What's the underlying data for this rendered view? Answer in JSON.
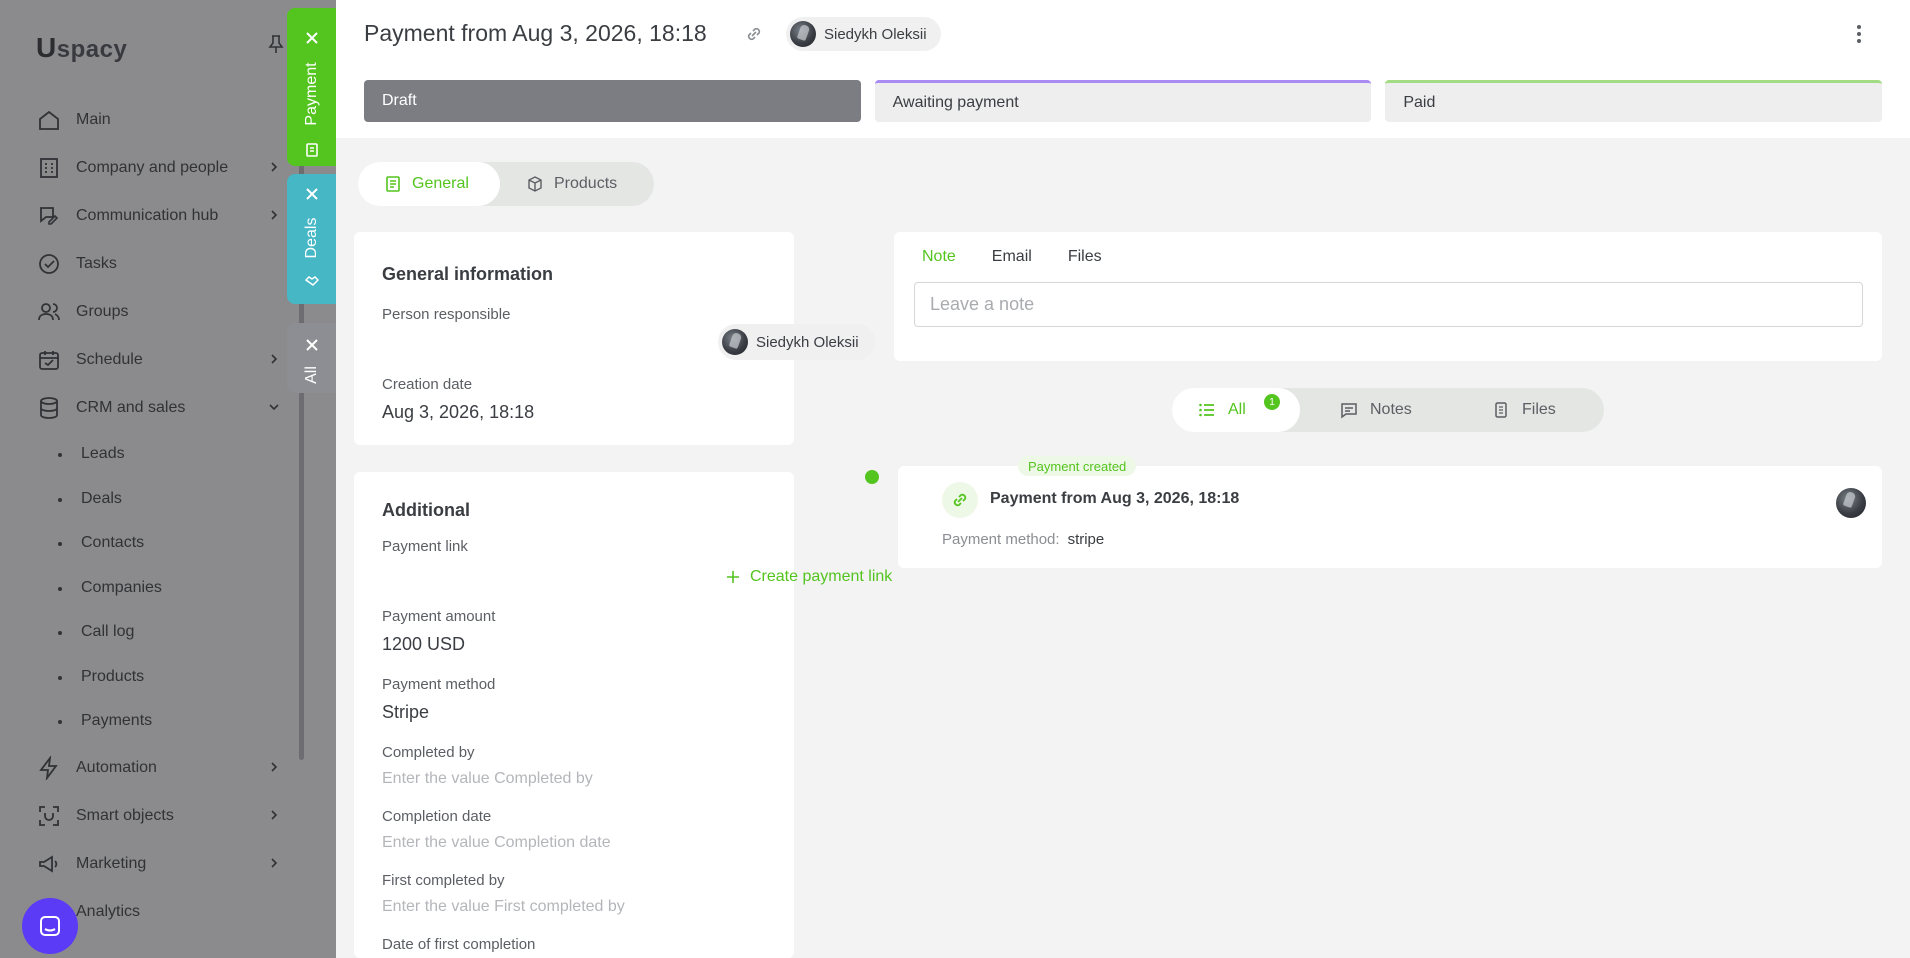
{
  "sidebar": {
    "logo": "spacy",
    "logo_u": "U",
    "items": [
      {
        "label": "Main"
      },
      {
        "label": "Company and people"
      },
      {
        "label": "Communication hub"
      },
      {
        "label": "Tasks"
      },
      {
        "label": "Groups"
      },
      {
        "label": "Schedule"
      },
      {
        "label": "CRM and sales"
      }
    ],
    "crm_sub": [
      "Leads",
      "Deals",
      "Contacts",
      "Companies",
      "Call log",
      "Products",
      "Payments"
    ],
    "items_after": [
      {
        "label": "Automation"
      },
      {
        "label": "Smart objects"
      },
      {
        "label": "Marketing"
      },
      {
        "label": "Analytics"
      }
    ]
  },
  "side_tabs": {
    "payment": "Payment",
    "deals": "Deals",
    "all": "All"
  },
  "header": {
    "title": "Payment from Aug 3, 2026, 18:18",
    "owner": "Siedykh Oleksii",
    "stages": [
      "Draft",
      "Awaiting payment",
      "Paid"
    ]
  },
  "view_tabs": {
    "general": "General",
    "products": "Products"
  },
  "general_info": {
    "title": "General information",
    "person_label": "Person responsible",
    "person_value": "Siedykh Oleksii",
    "creation_label": "Creation date",
    "creation_value": "Aug 3, 2026, 18:18"
  },
  "additional": {
    "title": "Additional",
    "payment_link_label": "Payment link",
    "create_link": "Create payment link",
    "amount_label": "Payment amount",
    "amount_value": "1200 USD",
    "method_label": "Payment method",
    "method_value": "Stripe",
    "completed_by_label": "Completed by",
    "completed_by_placeholder": "Enter the value Completed by",
    "completion_date_label": "Completion date",
    "completion_date_placeholder": "Enter the value Completion date",
    "first_completed_label": "First completed by",
    "first_completed_placeholder": "Enter the value First completed by",
    "first_completion_date_label": "Date of first completion"
  },
  "note_box": {
    "tabs": [
      "Note",
      "Email",
      "Files"
    ],
    "placeholder": "Leave a note"
  },
  "feed_filter": {
    "all": "All",
    "all_count": "1",
    "notes": "Notes",
    "files": "Files"
  },
  "event": {
    "tag": "Payment created",
    "title": "Payment from Aug 3, 2026, 18:18",
    "method_label": "Payment method:",
    "method_value": "stripe"
  },
  "colors": {
    "accent": "#54c41f",
    "deals_tab": "#45b7c5",
    "draft_stage": "#7b7d82",
    "awaiting_stage": "#a98bf3",
    "paid_stage": "#a4dc86",
    "chat_button": "#5b3bf5"
  }
}
